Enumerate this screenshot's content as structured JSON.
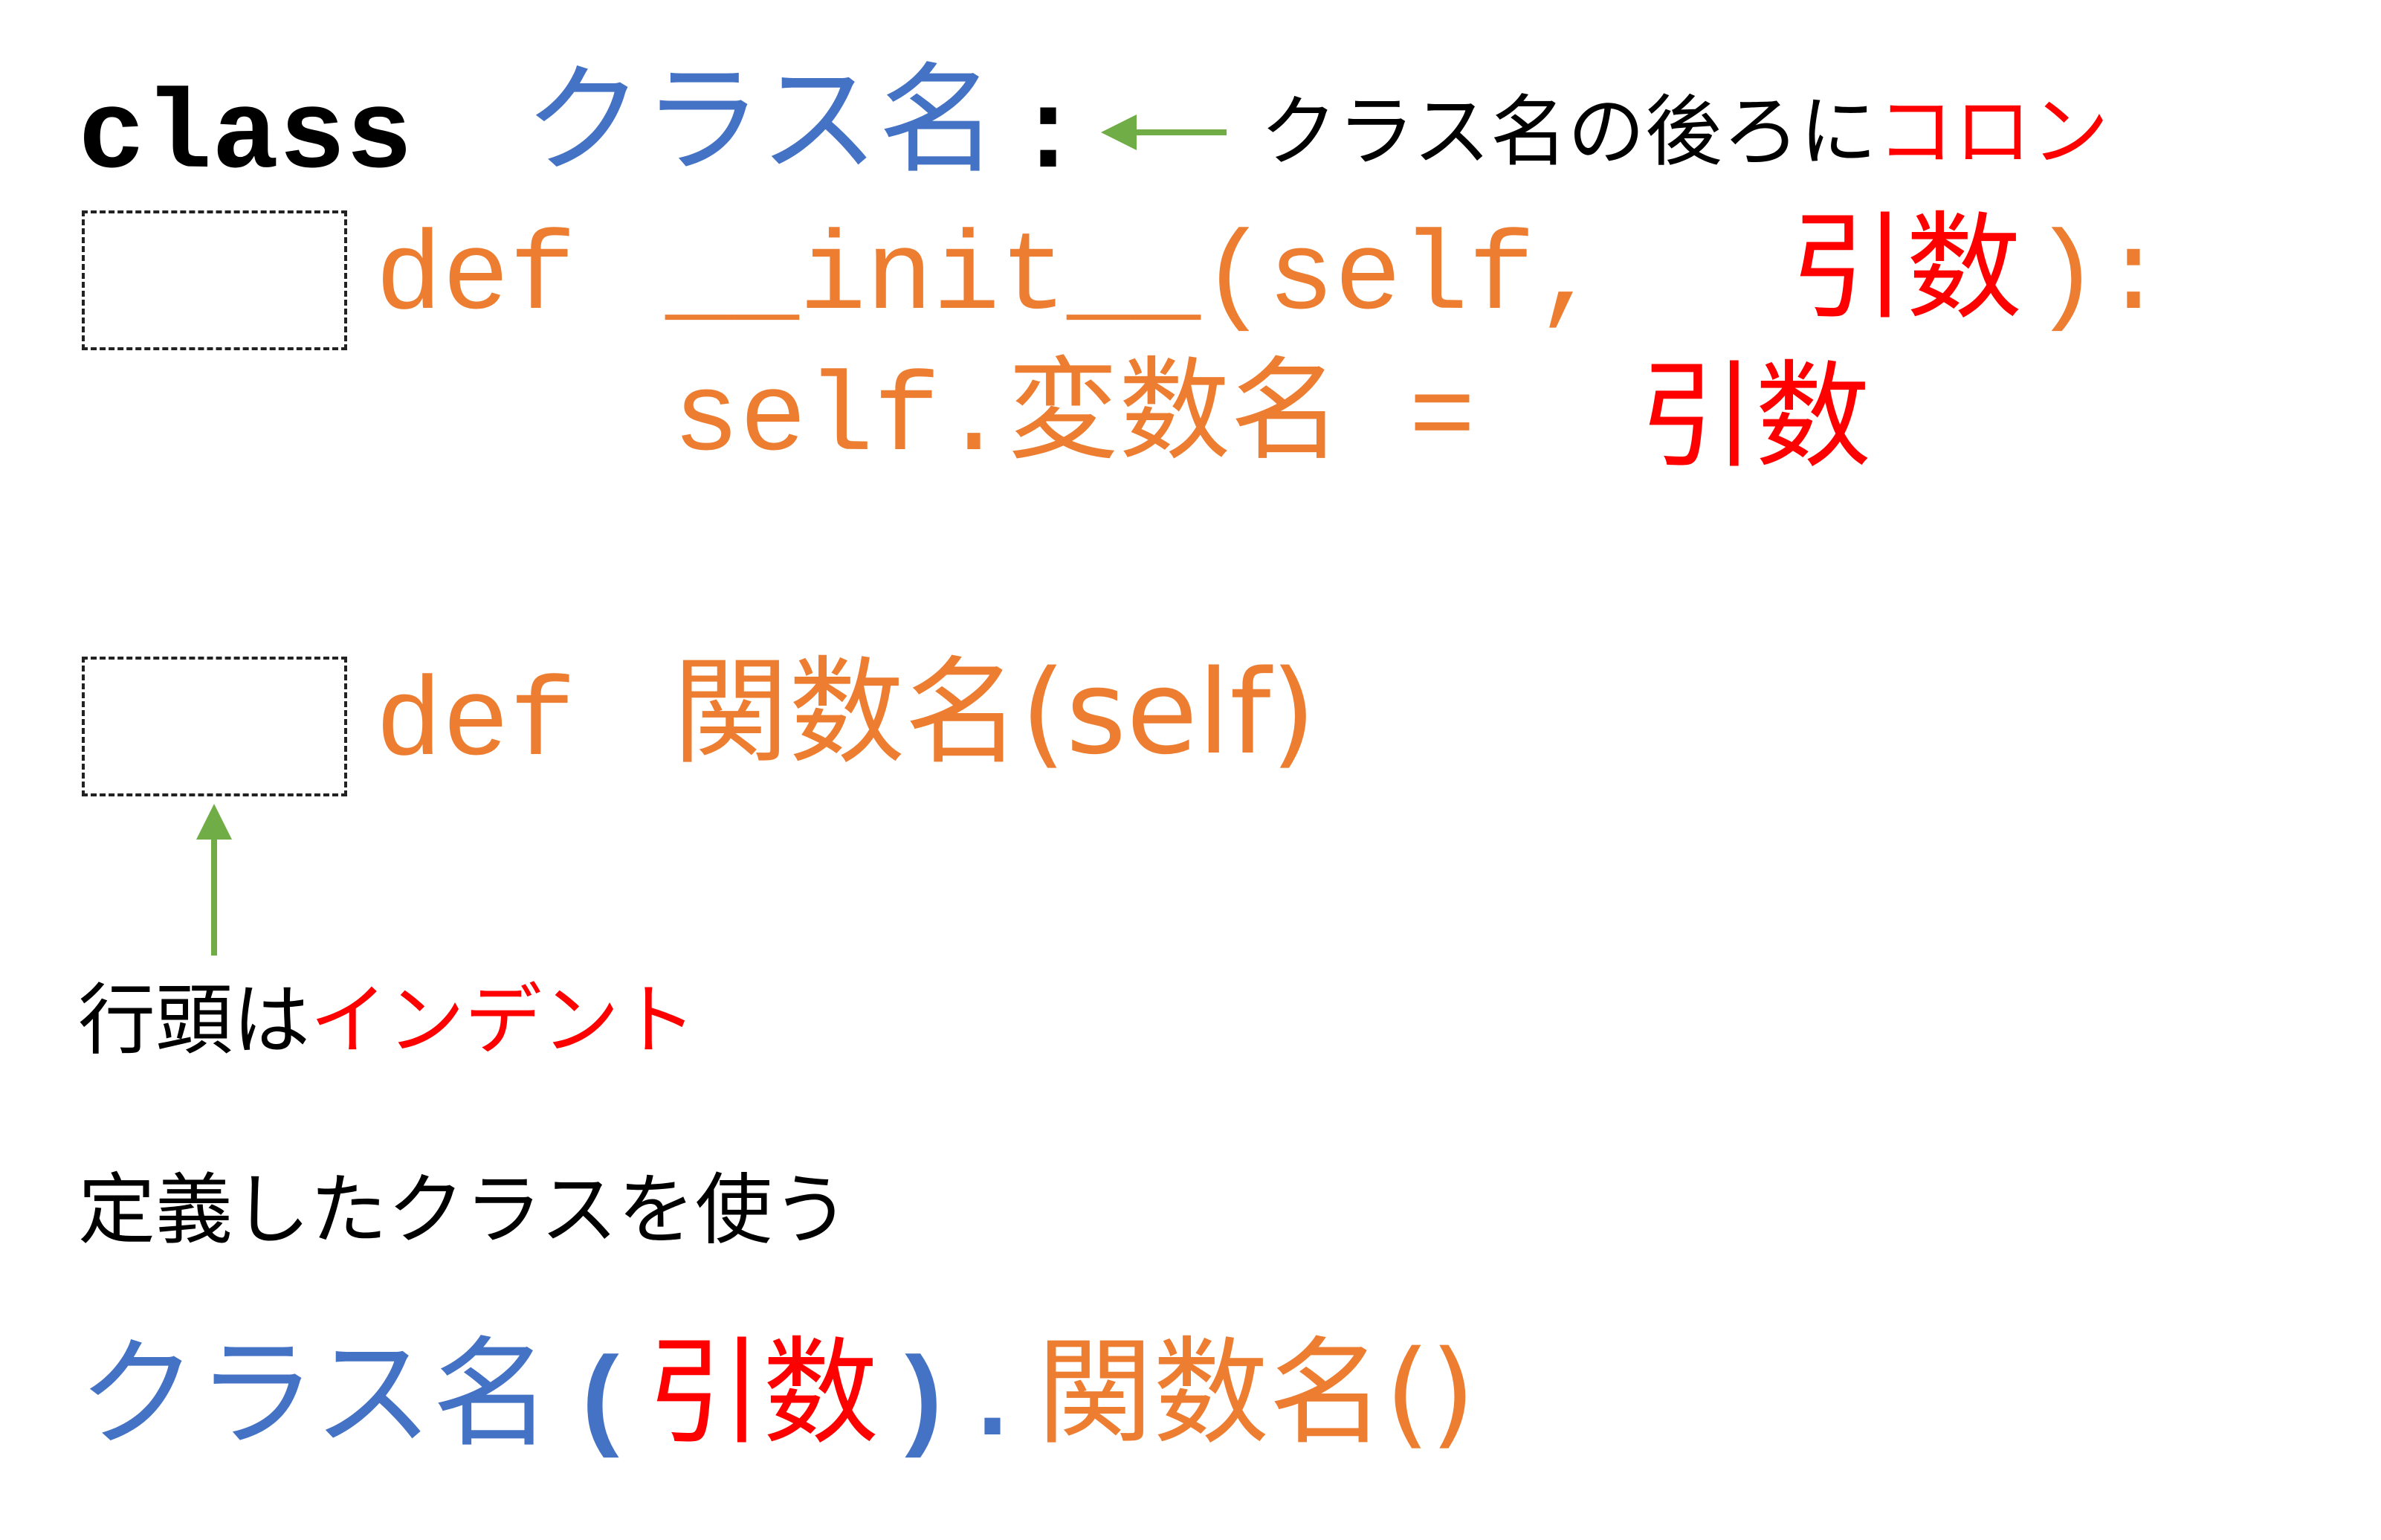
{
  "line1": {
    "keyword": "class",
    "class_name": "クラス名",
    "colon": ":",
    "note_prefix": "クラス名の後ろに",
    "note_highlight": "コロン"
  },
  "line2": {
    "def": "def",
    "func": "__init__(self,",
    "arg": "引数",
    "close": "):"
  },
  "line3": {
    "assign": "self.変数名 =",
    "arg": "引数"
  },
  "line4": {
    "def": "def",
    "func": "関数名(self)"
  },
  "indent_note": {
    "prefix": "行頭は",
    "highlight": "インデント"
  },
  "usage_heading": "定義したクラスを使う",
  "usage": {
    "class_name": "クラス名",
    "open": "(",
    "arg": "引数",
    "close": ")",
    "dot": ".",
    "method": "関数名()"
  },
  "colors": {
    "blue": "#4472C4",
    "orange": "#ED7D31",
    "red": "#FF0000",
    "arrow_green": "#70AD47"
  }
}
